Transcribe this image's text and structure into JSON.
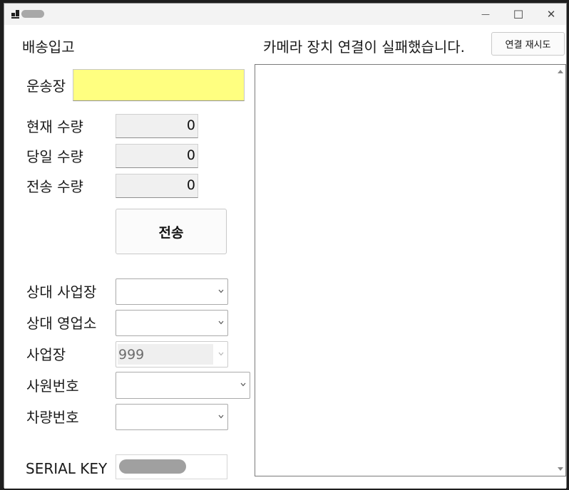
{
  "window": {
    "minimize": "—",
    "maximize": "☐",
    "close": "✕"
  },
  "form": {
    "title": "배송입고",
    "waybill_label": "운송장",
    "waybill_value": "",
    "current_qty_label": "현재 수량",
    "current_qty_value": "0",
    "today_qty_label": "당일 수량",
    "today_qty_value": "0",
    "sent_qty_label": "전송 수량",
    "sent_qty_value": "0",
    "send_button": "전송",
    "partner_site_label": "상대 사업장",
    "partner_site_value": "",
    "partner_office_label": "상대 영업소",
    "partner_office_value": "",
    "site_label": "사업장",
    "site_value": "999",
    "employee_no_label": "사원번호",
    "employee_no_value": "",
    "vehicle_no_label": "차량번호",
    "vehicle_no_value": "",
    "serial_key_label": "SERIAL KEY"
  },
  "camera": {
    "status_text": "카메라 장치 연결이 실패했습니다.",
    "retry_button": "연결 재시도"
  },
  "colors": {
    "waybill_background": "#ffff80"
  }
}
